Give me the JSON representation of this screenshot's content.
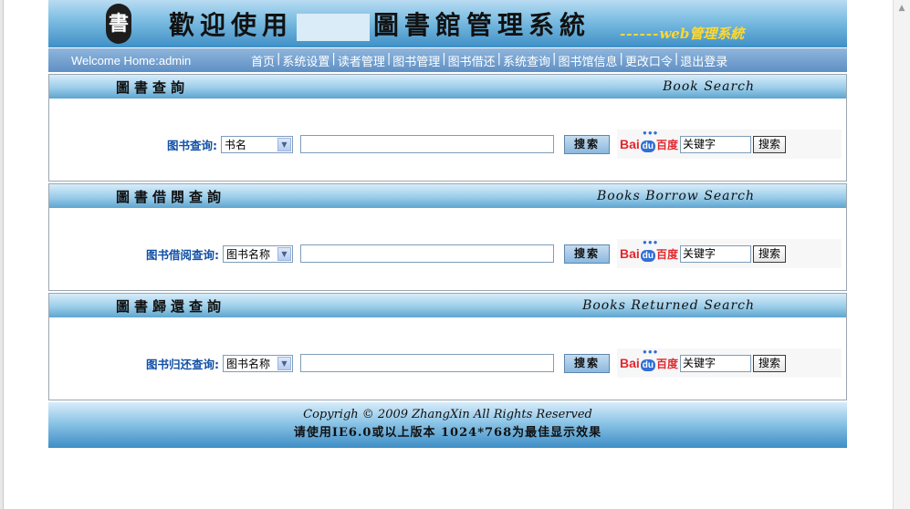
{
  "banner": {
    "seal_char": "書",
    "title_part1": "歡迎使用",
    "title_part2": "圖書館管理系統",
    "subtitle_dashes": "------",
    "subtitle": "web管理系統"
  },
  "nav": {
    "welcome": "Welcome Home:admin",
    "items": [
      "首页",
      "系统设置",
      "读者管理",
      "图书管理",
      "图书借还",
      "系统查询",
      "图书馆信息",
      "更改口令",
      "退出登录"
    ]
  },
  "sections": [
    {
      "title_cn": "圖書查詢",
      "title_en": "Book  Search",
      "label": "图书查询:",
      "select_value": "书名",
      "search_btn": "搜索",
      "kw_value": "关键字",
      "kw_btn": "搜索"
    },
    {
      "title_cn": "圖書借閱查詢",
      "title_en": "Books  Borrow  Search",
      "label": "图书借阅查询:",
      "select_value": "图书名称",
      "search_btn": "搜索",
      "kw_value": "关键字",
      "kw_btn": "搜索"
    },
    {
      "title_cn": "圖書歸還查詢",
      "title_en": "Books  Returned  Search",
      "label": "图书归还查询:",
      "select_value": "图书名称",
      "search_btn": "搜索",
      "kw_value": "关键字",
      "kw_btn": "搜索"
    }
  ],
  "baidu": {
    "bai": "Bai",
    "du": "du",
    "cn": "百度"
  },
  "footer": {
    "line1": "Copyrigh © 2009 ZhangXin    All Rights Reserved",
    "line2": "请使用IE6.0或以上版本  1024*768为最佳显示效果"
  },
  "colors": {
    "nav_bg": "#6f9fd0",
    "label_blue": "#1150a6",
    "subtitle_yellow": "#ffd92e",
    "baidu_red": "#e1282e"
  }
}
